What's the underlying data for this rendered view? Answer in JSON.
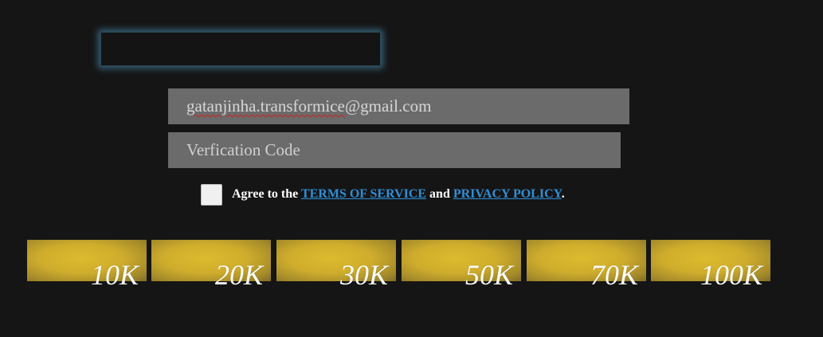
{
  "form": {
    "email_value": "gatanjinha.transformice@gmail.com",
    "email_misspelled_part": "gatanjinha.transformice",
    "email_rest": "@gmail.com",
    "code_placeholder": "Verfication Code"
  },
  "agree": {
    "prefix": "Agree to the",
    "terms_link": "TERMS OF SERVICE",
    "conjunction": "and",
    "privacy_link": "PRIVACY POLICY",
    "suffix": ".",
    "checked": false
  },
  "packages": [
    {
      "label": "10K"
    },
    {
      "label": "20K"
    },
    {
      "label": "30K"
    },
    {
      "label": "50K"
    },
    {
      "label": "70K"
    },
    {
      "label": "100K"
    }
  ],
  "colors": {
    "background": "#151515",
    "glow": "#52a0c8",
    "field": "#6b6b6b",
    "link": "#2d8fd8",
    "package_gold": "#cfad2c"
  }
}
